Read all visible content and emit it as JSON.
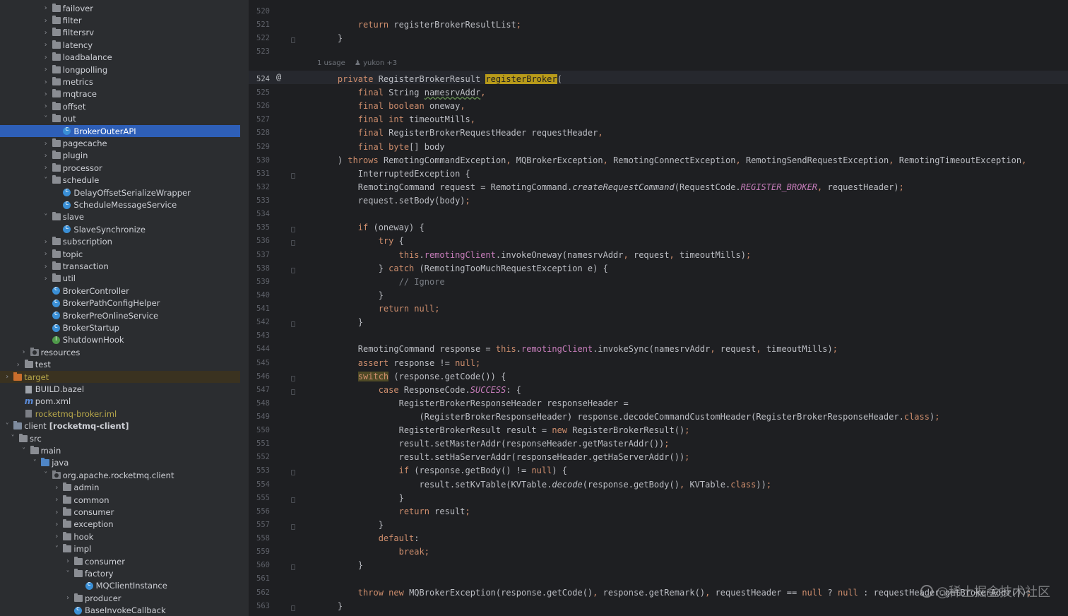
{
  "tree": {
    "items": [
      {
        "label": "failover"
      },
      {
        "label": "filter"
      },
      {
        "label": "filtersrv"
      },
      {
        "label": "latency"
      },
      {
        "label": "loadbalance"
      },
      {
        "label": "longpolling"
      },
      {
        "label": "metrics"
      },
      {
        "label": "mqtrace"
      },
      {
        "label": "offset"
      },
      {
        "label": "out"
      },
      {
        "label": "BrokerOuterAPI"
      },
      {
        "label": "pagecache"
      },
      {
        "label": "plugin"
      },
      {
        "label": "processor"
      },
      {
        "label": "schedule"
      },
      {
        "label": "DelayOffsetSerializeWrapper"
      },
      {
        "label": "ScheduleMessageService"
      },
      {
        "label": "slave"
      },
      {
        "label": "SlaveSynchronize"
      },
      {
        "label": "subscription"
      },
      {
        "label": "topic"
      },
      {
        "label": "transaction"
      },
      {
        "label": "util"
      },
      {
        "label": "BrokerController"
      },
      {
        "label": "BrokerPathConfigHelper"
      },
      {
        "label": "BrokerPreOnlineService"
      },
      {
        "label": "BrokerStartup"
      },
      {
        "label": "ShutdownHook"
      },
      {
        "label": "resources"
      },
      {
        "label": "test"
      },
      {
        "label": "target"
      },
      {
        "label": "BUILD.bazel"
      },
      {
        "label": "pom.xml"
      },
      {
        "label": "rocketmq-broker.iml"
      },
      {
        "label": "client",
        "suffix": "[rocketmq-client]"
      },
      {
        "label": "src"
      },
      {
        "label": "main"
      },
      {
        "label": "java"
      },
      {
        "label": "org.apache.rocketmq.client"
      },
      {
        "label": "admin"
      },
      {
        "label": "common"
      },
      {
        "label": "consumer"
      },
      {
        "label": "exception"
      },
      {
        "label": "hook"
      },
      {
        "label": "impl"
      },
      {
        "label": "consumer"
      },
      {
        "label": "factory"
      },
      {
        "label": "MQClientInstance"
      },
      {
        "label": "producer"
      },
      {
        "label": "BaseInvokeCallback"
      }
    ]
  },
  "editor": {
    "usage_hint": "1 usage",
    "author_hint": "yukon +3",
    "gutter_mark": "@",
    "line_numbers": [
      "520",
      "521",
      "522",
      "523",
      "524",
      "525",
      "526",
      "527",
      "528",
      "529",
      "530",
      "531",
      "532",
      "533",
      "534",
      "535",
      "536",
      "537",
      "538",
      "539",
      "540",
      "541",
      "542",
      "543",
      "544",
      "545",
      "546",
      "547",
      "548",
      "549",
      "550",
      "551",
      "552",
      "553",
      "554",
      "555",
      "556",
      "557",
      "558",
      "559",
      "560",
      "561",
      "562",
      "563"
    ],
    "code": [
      "        return registerBrokerResultList;",
      "    }",
      "",
      "    private RegisterBrokerResult registerBroker(",
      "        final String namesrvAddr,",
      "        final boolean oneway,",
      "        final int timeoutMills,",
      "        final RegisterBrokerRequestHeader requestHeader,",
      "        final byte[] body",
      "    ) throws RemotingCommandException, MQBrokerException, RemotingConnectException, RemotingSendRequestException, RemotingTimeoutException,",
      "        InterruptedException {",
      "        RemotingCommand request = RemotingCommand.createRequestCommand(RequestCode.REGISTER_BROKER, requestHeader);",
      "        request.setBody(body);",
      "",
      "        if (oneway) {",
      "            try {",
      "                this.remotingClient.invokeOneway(namesrvAddr, request, timeoutMills);",
      "            } catch (RemotingTooMuchRequestException e) {",
      "                // Ignore",
      "            }",
      "            return null;",
      "        }",
      "",
      "        RemotingCommand response = this.remotingClient.invokeSync(namesrvAddr, request, timeoutMills);",
      "        assert response != null;",
      "        switch (response.getCode()) {",
      "            case ResponseCode.SUCCESS: {",
      "                RegisterBrokerResponseHeader responseHeader =",
      "                    (RegisterBrokerResponseHeader) response.decodeCommandCustomHeader(RegisterBrokerResponseHeader.class);",
      "                RegisterBrokerResult result = new RegisterBrokerResult();",
      "                result.setMasterAddr(responseHeader.getMasterAddr());",
      "                result.setHaServerAddr(responseHeader.getHaServerAddr());",
      "                if (response.getBody() != null) {",
      "                    result.setKvTable(KVTable.decode(response.getBody(), KVTable.class));",
      "                }",
      "                return result;",
      "            }",
      "            default:",
      "                break;",
      "        }",
      "",
      "        throw new MQBrokerException(response.getCode(), response.getRemark(), requestHeader == null ? null : requestHeader.getBrokerAddr());",
      "    }"
    ]
  },
  "watermark": "@稀土掘金技术社区"
}
